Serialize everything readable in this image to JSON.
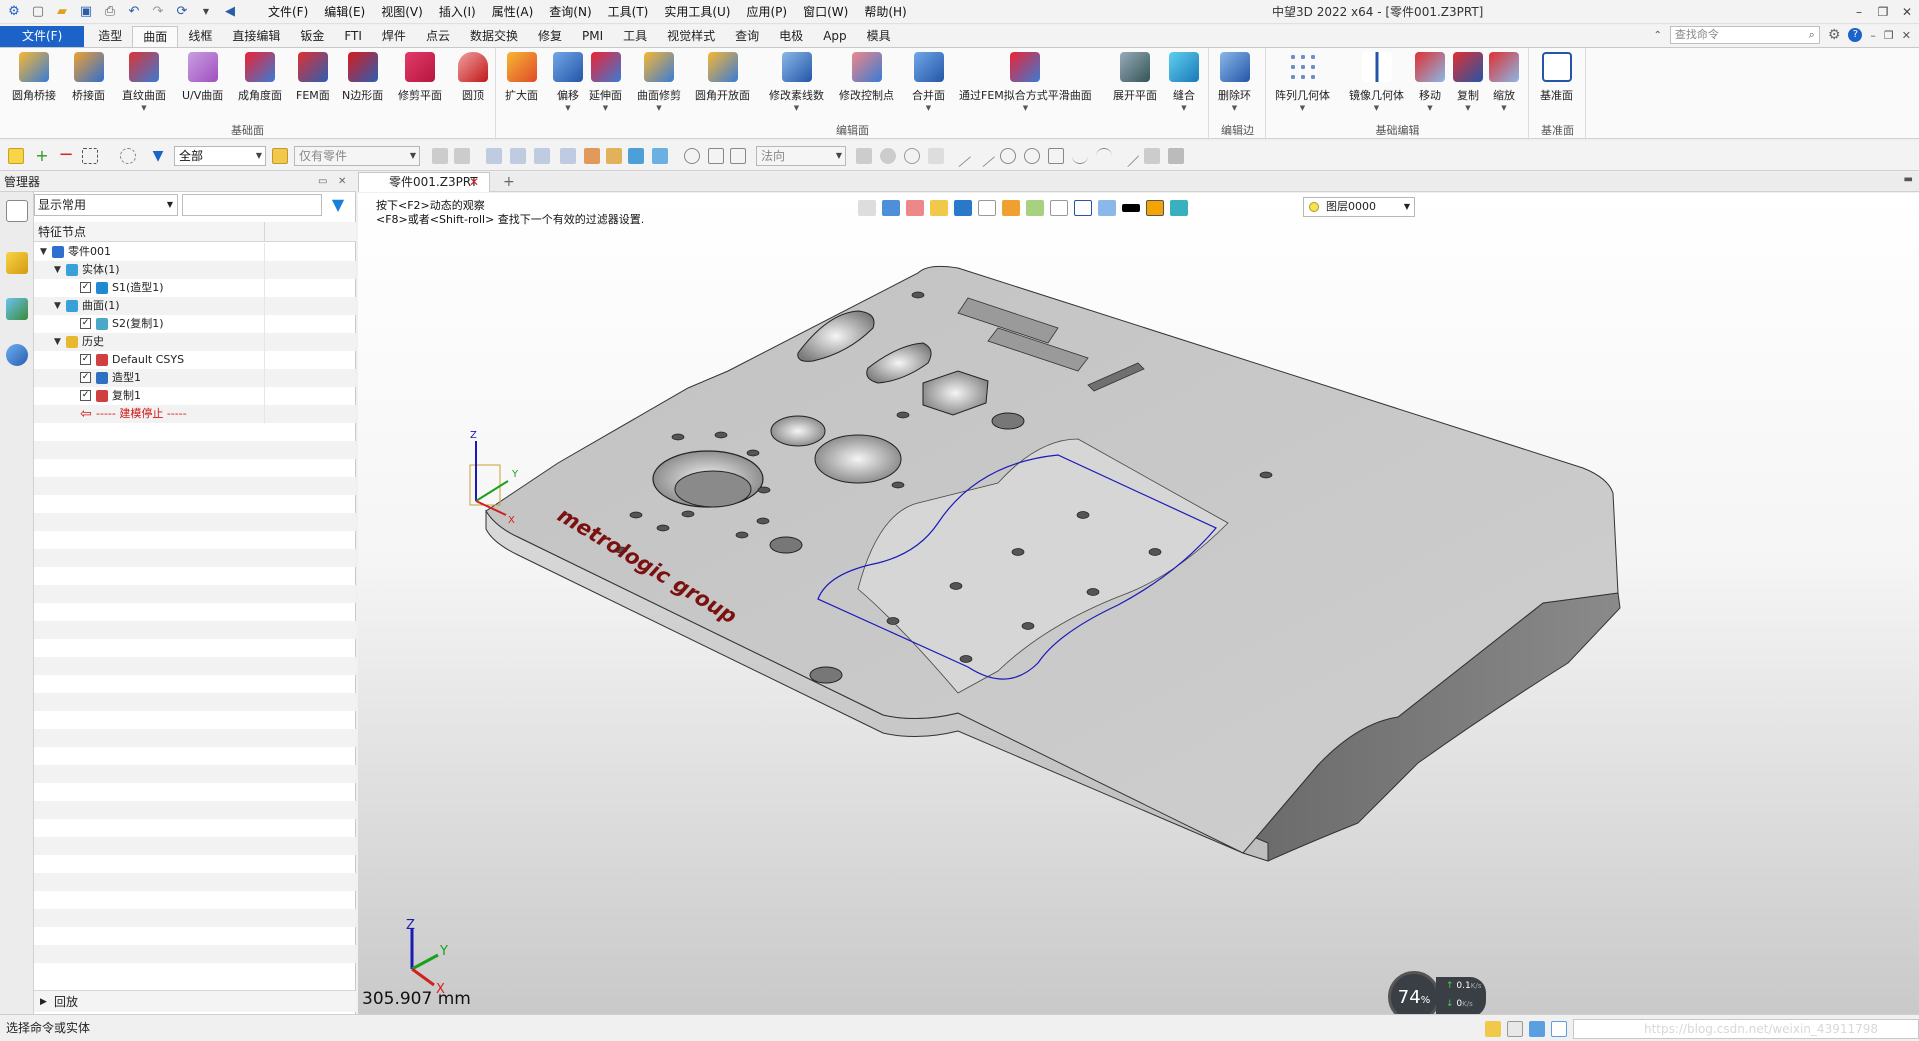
{
  "app": {
    "title": "中望3D 2022 x64 - [零件001.Z3PRT]"
  },
  "menu": [
    "文件(F)",
    "编辑(E)",
    "视图(V)",
    "插入(I)",
    "属性(A)",
    "查询(N)",
    "工具(T)",
    "实用工具(U)",
    "应用(P)",
    "窗口(W)",
    "帮助(H)"
  ],
  "tabs": [
    "文件(F)",
    "造型",
    "曲面",
    "线框",
    "直接编辑",
    "钣金",
    "FTI",
    "焊件",
    "点云",
    "数据交换",
    "修复",
    "PMI",
    "工具",
    "视觉样式",
    "查询",
    "电极",
    "App",
    "模具"
  ],
  "active_tab": "曲面",
  "search": {
    "placeholder": "查找命令"
  },
  "ribbon": {
    "groups": [
      {
        "label": "基础面",
        "buttons": [
          "圆角桥接",
          "桥接面",
          "直纹曲面",
          "U/V曲面",
          "成角度面",
          "FEM面",
          "N边形面",
          "修剪平面",
          "圆顶"
        ]
      },
      {
        "label": "编辑面",
        "buttons": [
          "扩大面",
          "偏移",
          "延伸面",
          "曲面修剪",
          "圆角开放面",
          "修改素线数",
          "修改控制点",
          "合并面",
          "通过FEM拟合方式平滑曲面",
          "展开平面",
          "缝合"
        ]
      },
      {
        "label": "编辑边",
        "buttons": [
          "删除环"
        ]
      },
      {
        "label": "基础编辑",
        "buttons": [
          "阵列几何体",
          "镜像几何体",
          "移动",
          "复制",
          "缩放"
        ]
      },
      {
        "label": "基准面",
        "buttons": [
          "基准面"
        ]
      }
    ]
  },
  "toolbar": {
    "filter_value": "全部",
    "scope_value": "仅有零件",
    "direction_value": "法向"
  },
  "manager": {
    "title": "管理器",
    "filter_value": "显示常用",
    "column_header": "特征节点",
    "tree": [
      {
        "label": "零件001",
        "level": 0,
        "toggle": "expanded",
        "check": false,
        "icon": "part"
      },
      {
        "label": "实体(1)",
        "level": 1,
        "toggle": "expanded",
        "check": false,
        "icon": "folder-solid"
      },
      {
        "label": "S1(造型1)",
        "level": 2,
        "toggle": "none",
        "check": true,
        "icon": "solid"
      },
      {
        "label": "曲面(1)",
        "level": 1,
        "toggle": "expanded",
        "check": false,
        "icon": "folder-surface"
      },
      {
        "label": "S2(复制1)",
        "level": 2,
        "toggle": "none",
        "check": true,
        "icon": "surface"
      },
      {
        "label": "历史",
        "level": 1,
        "toggle": "expanded",
        "check": false,
        "icon": "folder"
      },
      {
        "label": "Default CSYS",
        "level": 2,
        "toggle": "none",
        "check": true,
        "icon": "csys"
      },
      {
        "label": "造型1",
        "level": 2,
        "toggle": "none",
        "check": true,
        "icon": "shape"
      },
      {
        "label": "复制1",
        "level": 2,
        "toggle": "none",
        "check": true,
        "icon": "copy"
      },
      {
        "label": "----- 建模停止 -----",
        "level": 2,
        "toggle": "none",
        "check": false,
        "icon": "stop-arrow"
      }
    ],
    "playback_label": "回放"
  },
  "document": {
    "tab_label": "零件001.Z3PRT",
    "hint_line1": "按下<F2>动态的观察",
    "hint_line2": "<F8>或者<Shift-roll> 查找下一个有效的过滤器设置.",
    "layer": "图层0000",
    "model_text": "metrologic group",
    "measure": "305.907 mm",
    "speed_percent": "74",
    "speed_unit": "%",
    "upload": "0.1",
    "download": "0",
    "rate_unit": "K/s"
  },
  "statusbar": {
    "text": "选择命令或实体",
    "watermark": "https://blog.csdn.net/weixin_43911798"
  },
  "colors": {
    "accent": "#1b62c9",
    "model": "#c9c9c9",
    "edge_highlight": "#1a1ab8",
    "brand_text": "#7a1010"
  }
}
